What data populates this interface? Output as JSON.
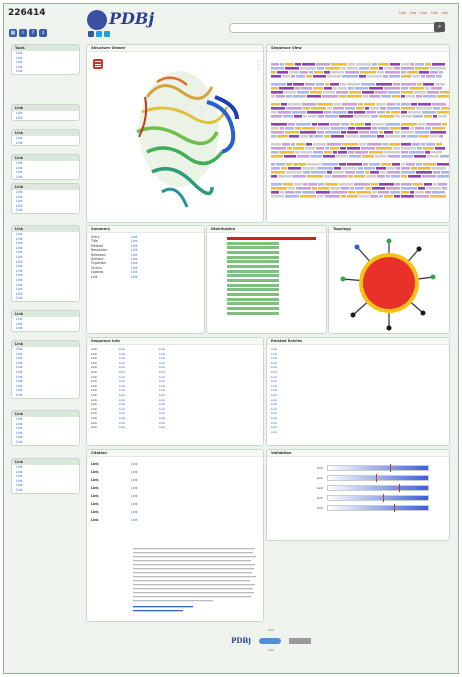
{
  "entry": {
    "id": "226414"
  },
  "header": {
    "brand": "PDBj",
    "toplinks": [
      "Link",
      "Link",
      "Link",
      "Link",
      "Link"
    ]
  },
  "sidebar": {
    "sections": [
      {
        "title": "Tools",
        "items": [
          "Link",
          "Link",
          "Link",
          "Link",
          "Link"
        ]
      },
      {
        "title": "Link",
        "items": [
          "Link",
          "Link"
        ]
      },
      {
        "title": "Link",
        "items": [
          "Link",
          "Link"
        ]
      },
      {
        "title": "Link",
        "items": [
          "Link",
          "Link",
          "Link",
          "Link"
        ]
      },
      {
        "title": "Link",
        "items": [
          "Link",
          "Link",
          "Link",
          "Link",
          "Link"
        ]
      },
      {
        "title": "Link",
        "items": [
          "Link",
          "Link",
          "Link",
          "Link",
          "Link",
          "Link",
          "Link",
          "Link",
          "Link",
          "Link",
          "Link",
          "Link",
          "Link",
          "Link",
          "Link"
        ]
      },
      {
        "title": "Link",
        "items": [
          "Link",
          "Link",
          "Link"
        ]
      },
      {
        "title": "Link",
        "items": [
          "Link",
          "Link",
          "Link",
          "Link",
          "Link",
          "Link",
          "Link",
          "Link",
          "Link",
          "Link",
          "Link"
        ]
      },
      {
        "title": "Link",
        "items": [
          "Link",
          "Link",
          "Link",
          "Link",
          "Link",
          "Link"
        ]
      },
      {
        "title": "Link",
        "items": [
          "Link",
          "Link",
          "Link",
          "Link",
          "Link",
          "Link"
        ]
      }
    ]
  },
  "panels": {
    "structure_title": "Structure Viewer",
    "sequence_title": "Sequence View",
    "summary_title": "Summary",
    "dist_title": "Distribution",
    "topology_title": "Topology",
    "seqinfo_title": "Sequence Info",
    "related_title": "Related Entries",
    "citation_title": "Citation",
    "validation_title": "Validation"
  },
  "summary_rows": [
    {
      "k": "Entry",
      "v": "Link"
    },
    {
      "k": "Title",
      "v": "Link"
    },
    {
      "k": "Method",
      "v": "Link"
    },
    {
      "k": "Resolution",
      "v": "Link"
    },
    {
      "k": "Released",
      "v": "Link"
    },
    {
      "k": "Authors",
      "v": "Link"
    },
    {
      "k": "Organism",
      "v": "Link"
    },
    {
      "k": "Chains",
      "v": "Link"
    },
    {
      "k": "Ligands",
      "v": "Link"
    },
    {
      "k": "Link",
      "v": "Link"
    }
  ],
  "seqinfo_rows": [
    {
      "a": "Link",
      "b": "Link",
      "c": "Link"
    },
    {
      "a": "Link",
      "b": "Link",
      "c": "Link"
    },
    {
      "a": "Link",
      "b": "Link",
      "c": "Link"
    },
    {
      "a": "Link",
      "b": "Link",
      "c": "Link"
    },
    {
      "a": "Link",
      "b": "Link",
      "c": "Link"
    },
    {
      "a": "Link",
      "b": "Link",
      "c": "Link"
    },
    {
      "a": "Link",
      "b": "Link",
      "c": "Link"
    },
    {
      "a": "Link",
      "b": "Link",
      "c": "Link"
    },
    {
      "a": "Link",
      "b": "Link",
      "c": "Link"
    },
    {
      "a": "Link",
      "b": "Link",
      "c": "Link"
    },
    {
      "a": "Link",
      "b": "Link",
      "c": "Link"
    },
    {
      "a": "Link",
      "b": "Link",
      "c": "Link"
    },
    {
      "a": "Link",
      "b": "Link",
      "c": "Link"
    },
    {
      "a": "Link",
      "b": "Link",
      "c": "Link"
    },
    {
      "a": "Link",
      "b": "Link",
      "c": "Link"
    },
    {
      "a": "Link",
      "b": "Link",
      "c": "Link"
    },
    {
      "a": "Link",
      "b": "Link",
      "c": "Link"
    },
    {
      "a": "Link",
      "b": "Link",
      "c": "Link"
    }
  ],
  "related": [
    "Link",
    "Link",
    "Link",
    "Link",
    "Link",
    "Link",
    "Link",
    "Link",
    "Link",
    "Link",
    "Link",
    "Link",
    "Link",
    "Link",
    "Link",
    "Link",
    "Link",
    "Link",
    "Link"
  ],
  "citation_rows": [
    {
      "k": "Link",
      "v": "Link"
    },
    {
      "k": "Link",
      "v": "Link"
    },
    {
      "k": "Link",
      "v": "Link"
    },
    {
      "k": "Link",
      "v": "Link"
    },
    {
      "k": "Link",
      "v": "Link"
    },
    {
      "k": "Link",
      "v": "Link"
    },
    {
      "k": "Link",
      "v": "Link"
    },
    {
      "k": "Link",
      "v": "Link"
    }
  ],
  "validation_labels": [
    "Link",
    "Link",
    "Link",
    "Link",
    "Link"
  ],
  "validation_levels": [
    0.62,
    0.48,
    0.71,
    0.55,
    0.66
  ],
  "dist_levels": [
    0.95,
    0.55,
    0.55,
    0.55,
    0.55,
    0.55,
    0.55,
    0.55,
    0.55,
    0.55,
    0.55,
    0.55,
    0.55,
    0.55,
    0.55,
    0.55,
    0.55
  ],
  "footer": {
    "links": "Link",
    "copyright": "Link"
  },
  "colors": {
    "accent": "#2c3f8f",
    "link": "#3366cc",
    "red": "#cc2222",
    "green": "#7fbf7f"
  }
}
